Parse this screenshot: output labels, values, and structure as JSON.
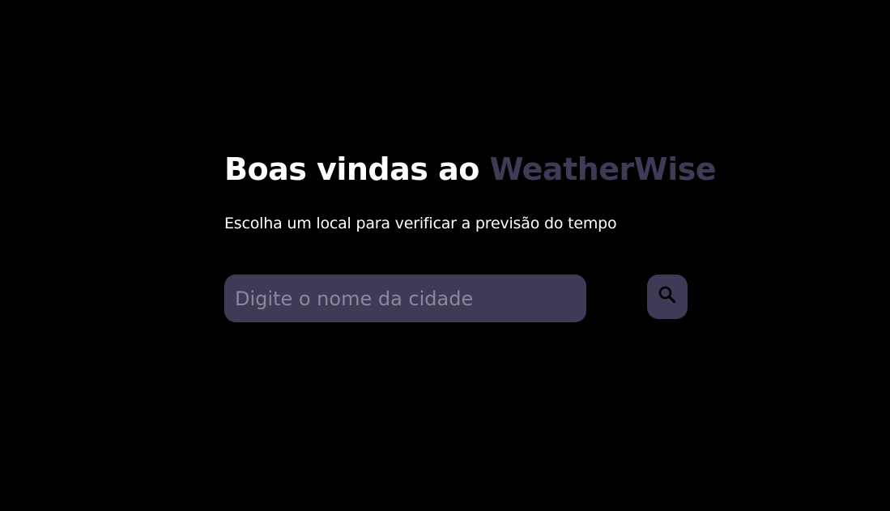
{
  "welcome": {
    "title_prefix": "Boas vindas ao ",
    "brand": "WeatherWise",
    "subtitle": "Escolha um local para verificar a previsão do tempo"
  },
  "search": {
    "placeholder": "Digite o nome da cidade",
    "value": "",
    "button_icon": "search-icon"
  },
  "colors": {
    "background": "#000000",
    "accent": "#3d3b55",
    "text": "#ffffff",
    "placeholder": "#8a889c"
  }
}
